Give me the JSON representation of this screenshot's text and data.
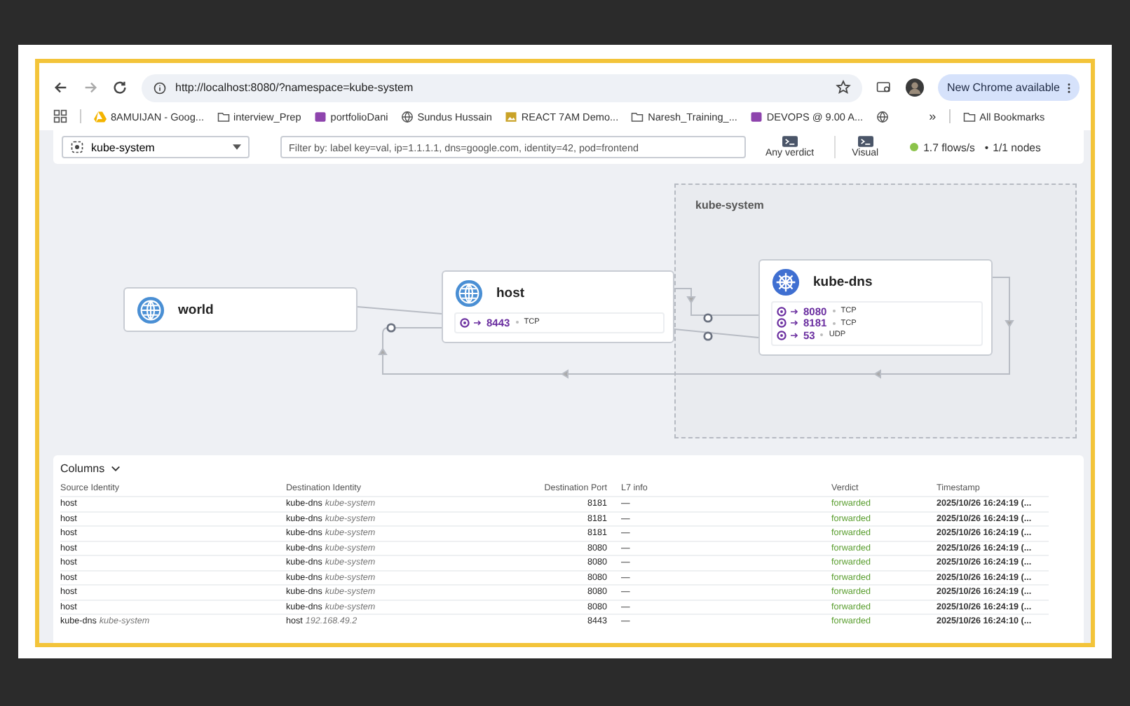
{
  "browser": {
    "url": "http://localhost:8080/?namespace=kube-system",
    "update_button": "New Chrome available",
    "bookmarks": [
      {
        "label": "8AMUIJAN - Goog...",
        "kind": "drive"
      },
      {
        "label": "interview_Prep",
        "kind": "folder"
      },
      {
        "label": "portfolioDani",
        "kind": "app"
      },
      {
        "label": "Sundus Hussain",
        "kind": "site"
      },
      {
        "label": "REACT 7AM Demo...",
        "kind": "image"
      },
      {
        "label": "Naresh_Training_...",
        "kind": "folder"
      },
      {
        "label": "DEVOPS @ 9.00 A...",
        "kind": "app"
      },
      {
        "kind": "site"
      }
    ],
    "more": "»",
    "all_bookmarks": "All Bookmarks"
  },
  "toolbar": {
    "namespace": "kube-system",
    "filter_placeholder": "Filter by: label key=val, ip=1.1.1.1, dns=google.com, identity=42, pod=frontend",
    "buttons": [
      "Any verdict",
      "Visual"
    ],
    "flows": "1.7 flows/s",
    "separator": "•",
    "nodes": "1/1 nodes"
  },
  "graph": {
    "namespace_label": "kube-system",
    "nodes": [
      {
        "name": "world",
        "kind": "external"
      },
      {
        "name": "host",
        "kind": "external",
        "ports": [
          {
            "port": "8443",
            "protocol": "TCP"
          }
        ]
      },
      {
        "name": "kube-dns",
        "kind": "service",
        "ports": [
          {
            "port": "8080",
            "protocol": "TCP"
          },
          {
            "port": "8181",
            "protocol": "TCP"
          },
          {
            "port": "53",
            "protocol": "UDP"
          }
        ]
      }
    ]
  },
  "table": {
    "columns_button": "Columns",
    "columns": [
      "Source Identity",
      "Destination Identity",
      "Destination Port",
      "L7 info",
      "Verdict",
      "Timestamp"
    ],
    "rows": [
      {
        "source": "host",
        "destination": "kube-dns",
        "destination_detail": "kube-system",
        "port": "8181",
        "l7": "—",
        "verdict": "forwarded",
        "timestamp": "2025/10/26 16:24:19 (..."
      },
      {
        "source": "host",
        "destination": "kube-dns",
        "destination_detail": "kube-system",
        "port": "8181",
        "l7": "—",
        "verdict": "forwarded",
        "timestamp": "2025/10/26 16:24:19 (..."
      },
      {
        "source": "host",
        "destination": "kube-dns",
        "destination_detail": "kube-system",
        "port": "8181",
        "l7": "—",
        "verdict": "forwarded",
        "timestamp": "2025/10/26 16:24:19 (..."
      },
      {
        "source": "host",
        "destination": "kube-dns",
        "destination_detail": "kube-system",
        "port": "8080",
        "l7": "—",
        "verdict": "forwarded",
        "timestamp": "2025/10/26 16:24:19 (..."
      },
      {
        "source": "host",
        "destination": "kube-dns",
        "destination_detail": "kube-system",
        "port": "8080",
        "l7": "—",
        "verdict": "forwarded",
        "timestamp": "2025/10/26 16:24:19 (..."
      },
      {
        "source": "host",
        "destination": "kube-dns",
        "destination_detail": "kube-system",
        "port": "8080",
        "l7": "—",
        "verdict": "forwarded",
        "timestamp": "2025/10/26 16:24:19 (..."
      },
      {
        "source": "host",
        "destination": "kube-dns",
        "destination_detail": "kube-system",
        "port": "8080",
        "l7": "—",
        "verdict": "forwarded",
        "timestamp": "2025/10/26 16:24:19 (..."
      },
      {
        "source": "host",
        "destination": "kube-dns",
        "destination_detail": "kube-system",
        "port": "8080",
        "l7": "—",
        "verdict": "forwarded",
        "timestamp": "2025/10/26 16:24:19 (..."
      },
      {
        "source": "kube-dns",
        "source_detail": "kube-system",
        "destination": "host",
        "destination_detail": "192.168.49.2",
        "port": "8443",
        "l7": "—",
        "verdict": "forwarded",
        "timestamp": "2025/10/26 16:24:10 (..."
      }
    ]
  }
}
